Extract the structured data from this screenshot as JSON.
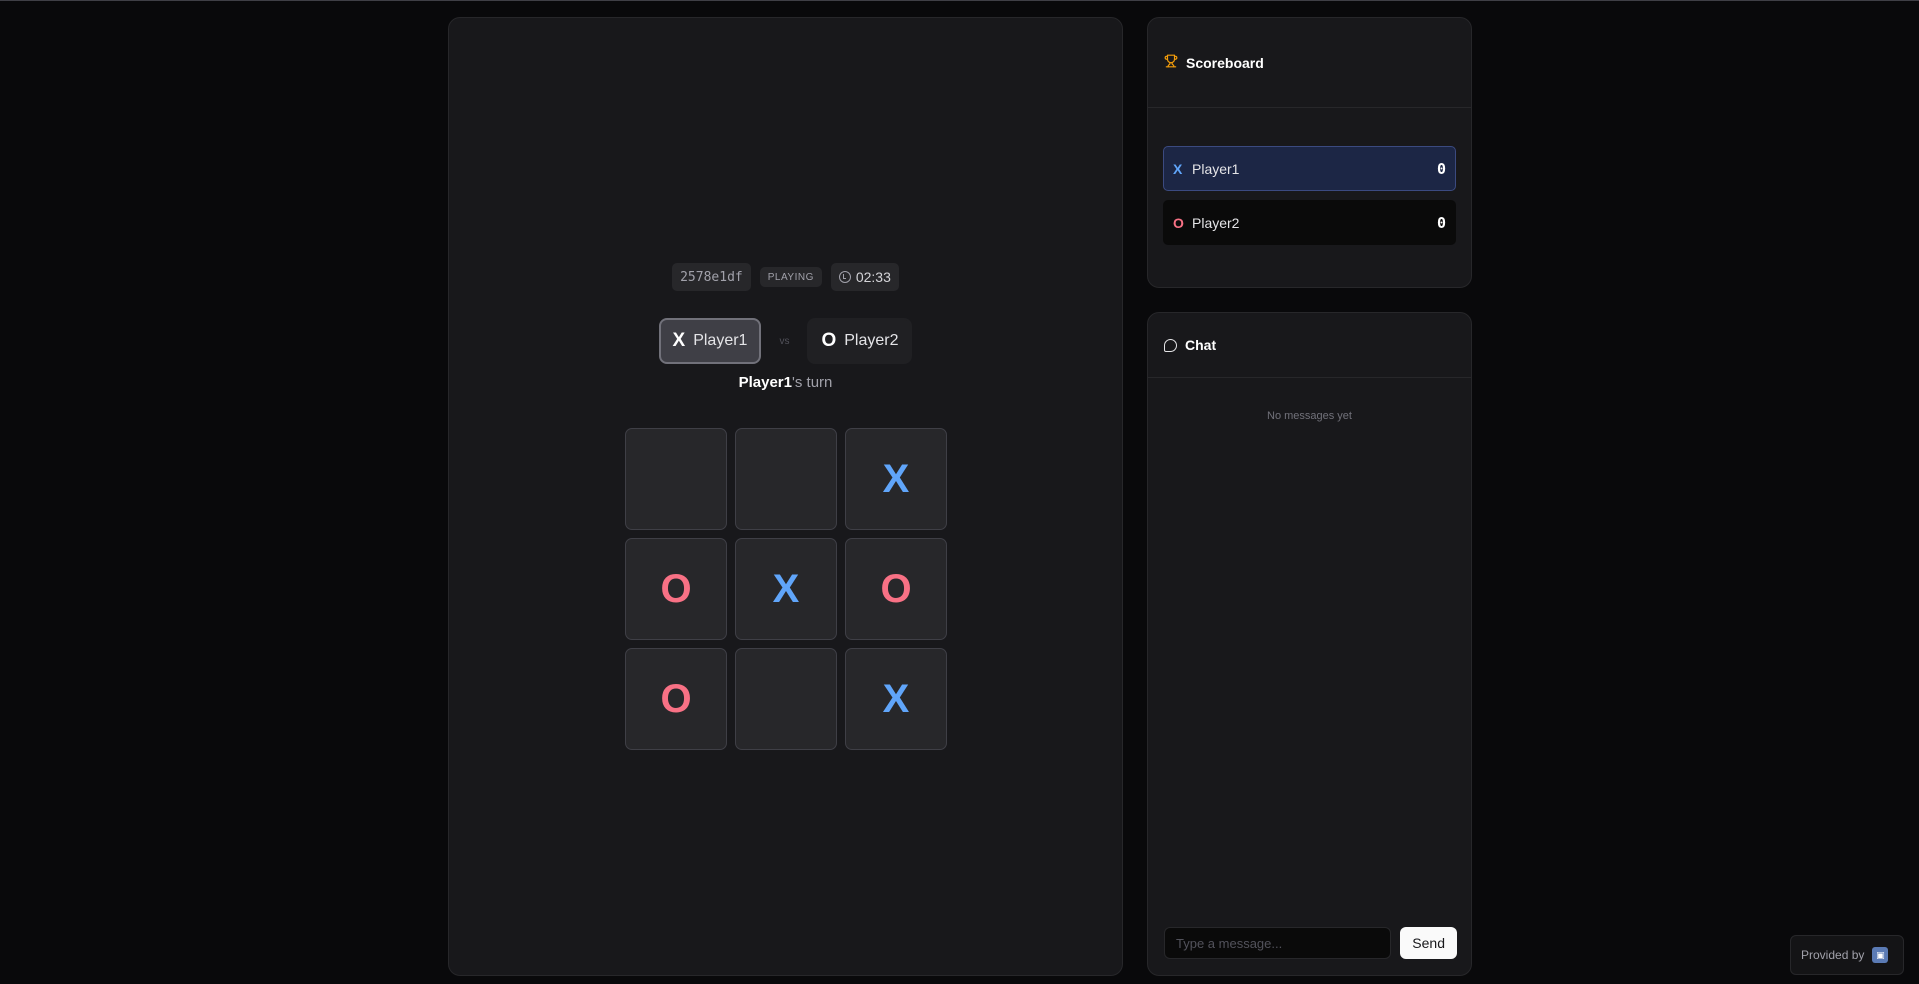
{
  "game": {
    "room_code": "2578e1df",
    "status": "PLAYING",
    "timer": "02:33",
    "vs_label": "vs",
    "player_x": {
      "mark": "X",
      "name": "Player1"
    },
    "player_o": {
      "mark": "O",
      "name": "Player2"
    },
    "turn": {
      "player": "Player1",
      "suffix": "'s turn"
    },
    "board": [
      "",
      "",
      "X",
      "O",
      "X",
      "O",
      "O",
      "",
      "X"
    ]
  },
  "scoreboard": {
    "title": "Scoreboard",
    "icon": "trophy-icon",
    "rows": [
      {
        "mark": "X",
        "name": "Player1",
        "score": "0"
      },
      {
        "mark": "O",
        "name": "Player2",
        "score": "0"
      }
    ]
  },
  "chat": {
    "title": "Chat",
    "icon": "chat-bubble-icon",
    "empty_text": "No messages yet",
    "input_placeholder": "Type a message...",
    "input_value": "",
    "send_label": "Send"
  },
  "provided_by": {
    "label": "Provided by"
  },
  "colors": {
    "background": "#09090b",
    "panel": "#18181b",
    "x_mark": "#60a5fa",
    "o_mark": "#f87185",
    "trophy": "#f59e0b",
    "leading_row": "#1c2645"
  }
}
